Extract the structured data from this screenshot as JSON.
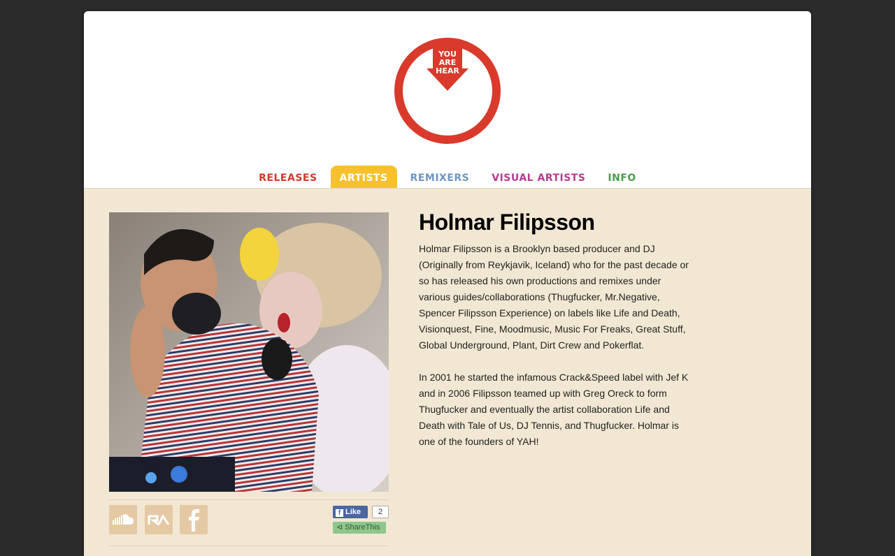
{
  "logo": {
    "lines": [
      "YOU",
      "ARE",
      "HEAR"
    ],
    "color": "#d93a2b"
  },
  "nav": {
    "items": [
      {
        "label": "RELEASES",
        "color": "#cf3a2c",
        "active": false
      },
      {
        "label": "ARTISTS",
        "color": "#f6c12c",
        "active": true
      },
      {
        "label": "REMIXERS",
        "color": "#6d95c4",
        "active": false
      },
      {
        "label": "VISUAL ARTISTS",
        "color": "#b53b8f",
        "active": false
      },
      {
        "label": "INFO",
        "color": "#4a9e4a",
        "active": false
      }
    ]
  },
  "artist": {
    "name": "Holmar Filipsson",
    "bio": [
      "Holmar Filipsson is a Brooklyn based producer and DJ (Originally from Reykjavik, Iceland) who for the past decade or so has released his own productions and remixes under various guides/collaborations (Thugfucker, Mr.Negative, Spencer Filipsson Experience) on labels like Life and Death, Visionquest, Fine, Moodmusic, Music For Freaks, Great Stuff, Global Underground, Plant, Dirt Crew and Pokerflat.",
      "In 2001 he started the infamous Crack&Speed label with Jef K and in 2006 Filipsson teamed up with Greg Oreck to form Thugfucker and eventually the artist collaboration Life and Death with Tale of Us, DJ Tennis, and Thugfucker.  Holmar is one of the founders of YAH!"
    ]
  },
  "social": {
    "icons": [
      "soundcloud-icon",
      "resident-advisor-icon",
      "facebook-icon"
    ],
    "like_label": "Like",
    "like_count": "2",
    "share_label": "ShareThis"
  }
}
